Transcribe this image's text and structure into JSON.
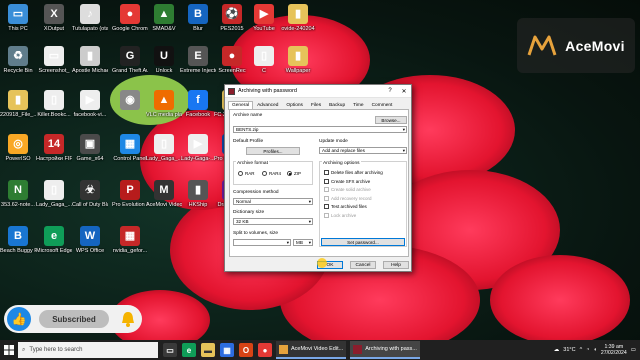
{
  "desktop": {
    "icons": [
      {
        "label": "This PC",
        "glyph": "▭",
        "color": "#3a8ed8"
      },
      {
        "label": "XOutput",
        "glyph": "X",
        "color": "#555"
      },
      {
        "label": "Tutulapato (otan cover)",
        "glyph": "♪",
        "color": "#ddd"
      },
      {
        "label": "Google Chrome",
        "glyph": "●",
        "color": "#e53935"
      },
      {
        "label": "SMAD&V",
        "glyph": "▲",
        "color": "#2e7d32"
      },
      {
        "label": "Blur",
        "glyph": "B",
        "color": "#1565c0"
      },
      {
        "label": "PES2015",
        "glyph": "⚽",
        "color": "#c62828"
      },
      {
        "label": "YouTube",
        "glyph": "▶",
        "color": "#e53935"
      },
      {
        "label": "ovide-240204",
        "glyph": "▮",
        "color": "#e6c35a"
      },
      {
        "label": "Recycle Bin",
        "glyph": "♻",
        "color": "#607d8b"
      },
      {
        "label": "Screenshot_",
        "glyph": "▭",
        "color": "#eee"
      },
      {
        "label": "Apostle Michael Oro...",
        "glyph": "▮",
        "color": "#ccc"
      },
      {
        "label": "Grand Theft Auto",
        "glyph": "G",
        "color": "#222"
      },
      {
        "label": "Unlock",
        "glyph": "U",
        "color": "#111"
      },
      {
        "label": "Extreme Injector v3",
        "glyph": "E",
        "color": "#555"
      },
      {
        "label": "ScreenRec",
        "glyph": "●",
        "color": "#c62828"
      },
      {
        "label": "C",
        "glyph": "▯",
        "color": "#eee"
      },
      {
        "label": "Wallpaper",
        "glyph": "▮",
        "color": "#e6c35a"
      },
      {
        "label": "220918_File_...",
        "glyph": "▮",
        "color": "#e6c35a"
      },
      {
        "label": "Killer.Bookc...",
        "glyph": "▯",
        "color": "#eee"
      },
      {
        "label": "facebook-vi...",
        "glyph": "▶",
        "color": "#eee"
      },
      {
        "label": "",
        "glyph": "◉",
        "color": "#888"
      },
      {
        "label": "VLC media player",
        "glyph": "▲",
        "color": "#ef6c00"
      },
      {
        "label": "Facebook",
        "glyph": "f",
        "color": "#1877f2"
      },
      {
        "label": "FC 24 Multimedia",
        "glyph": "▮",
        "color": "#e6c35a"
      },
      {
        "label": "Crystal_Cast...",
        "glyph": "▯",
        "color": "#eee"
      },
      {
        "label": "How-to-upd...",
        "glyph": "▶",
        "color": "#eee"
      },
      {
        "label": "PowerISO",
        "glyph": "◎",
        "color": "#f9a825"
      },
      {
        "label": "Настройки FIFA14",
        "glyph": "14",
        "color": "#c62828"
      },
      {
        "label": "Game_x64",
        "glyph": "▣",
        "color": "#4a4a4a"
      },
      {
        "label": "Control Panel",
        "glyph": "▦",
        "color": "#1e88e5"
      },
      {
        "label": "Lady_Gaga_...",
        "glyph": "▯",
        "color": "#eee"
      },
      {
        "label": "Lady-Gaga-...",
        "glyph": "▶",
        "color": "#eee"
      },
      {
        "label": "Pro Evolution Soccer 2016",
        "glyph": "P",
        "color": "#0d47a1"
      },
      {
        "label": "µTorrent",
        "glyph": "µ",
        "color": "#43a047"
      },
      {
        "label": "gta_sa",
        "glyph": "G",
        "color": "#444"
      },
      {
        "label": "353.62-note...",
        "glyph": "N",
        "color": "#2e7d32"
      },
      {
        "label": "Lady_Gaga_...",
        "glyph": "▯",
        "color": "#eee"
      },
      {
        "label": "Call of Duty Black Ops",
        "glyph": "☣",
        "color": "#333"
      },
      {
        "label": "Pro Evolution Soccer 201...",
        "glyph": "P",
        "color": "#b71c1c"
      },
      {
        "label": "AceMovi Video Editor",
        "glyph": "M",
        "color": "#333"
      },
      {
        "label": "HKShip",
        "glyph": "▮",
        "color": "#555"
      },
      {
        "label": "Dragon City",
        "glyph": "D",
        "color": "#6a1b9a"
      },
      {
        "label": "",
        "glyph": "▲",
        "color": "#c62828"
      },
      {
        "label": "",
        "glyph": "▲",
        "color": "#ef6c00"
      },
      {
        "label": "Beach Buggy Racing",
        "glyph": "B",
        "color": "#1976d2"
      },
      {
        "label": "Microsoft Edge",
        "glyph": "e",
        "color": "#0f9d58"
      },
      {
        "label": "WPS Office",
        "glyph": "W",
        "color": "#1565c0"
      },
      {
        "label": "nvidia_gefor...",
        "glyph": "▦",
        "color": "#c62828"
      }
    ]
  },
  "logo": {
    "text": "AceMovi"
  },
  "subscribe": {
    "label": "Subscribed"
  },
  "dialog": {
    "title": "Archiving with password",
    "help_btn": "?",
    "close_btn": "✕",
    "tabs": [
      "General",
      "Advanced",
      "Options",
      "Files",
      "Backup",
      "Time",
      "Comment"
    ],
    "archive_name_label": "Archive name",
    "archive_name_value": "BENTS.zip",
    "browse": "Browse...",
    "default_profile_label": "Default Profile",
    "profiles_btn": "Profiles...",
    "update_mode_label": "Update mode",
    "update_mode_value": "Add and replace files",
    "archive_format_label": "Archive format",
    "formats": [
      "RAR",
      "RAR4",
      "ZIP"
    ],
    "selected_format": "ZIP",
    "compression_label": "Compression method",
    "compression_value": "Normal",
    "dictionary_label": "Dictionary size",
    "dictionary_value": "32 KB",
    "split_label": "Split to volumes, size",
    "split_unit": "MB",
    "archiving_options_label": "Archiving options",
    "options": [
      {
        "label": "Delete files after archiving",
        "checked": false,
        "disabled": false
      },
      {
        "label": "Create SFX archive",
        "checked": false,
        "disabled": false
      },
      {
        "label": "Create solid archive",
        "checked": false,
        "disabled": true
      },
      {
        "label": "Add recovery record",
        "checked": false,
        "disabled": true
      },
      {
        "label": "Test archived files",
        "checked": false,
        "disabled": false
      },
      {
        "label": "Lock archive",
        "checked": false,
        "disabled": true
      }
    ],
    "set_password": "Set password...",
    "ok": "OK",
    "cancel": "Cancel",
    "help": "Help"
  },
  "taskbar": {
    "search_placeholder": "Type here to search",
    "apps": [
      {
        "label": "AceMovi Video Edit...",
        "focus": false
      },
      {
        "label": "Archiving with pass...",
        "focus": true
      }
    ],
    "weather": "31°C",
    "time": "1:39 am",
    "date": "27/02/2024"
  }
}
